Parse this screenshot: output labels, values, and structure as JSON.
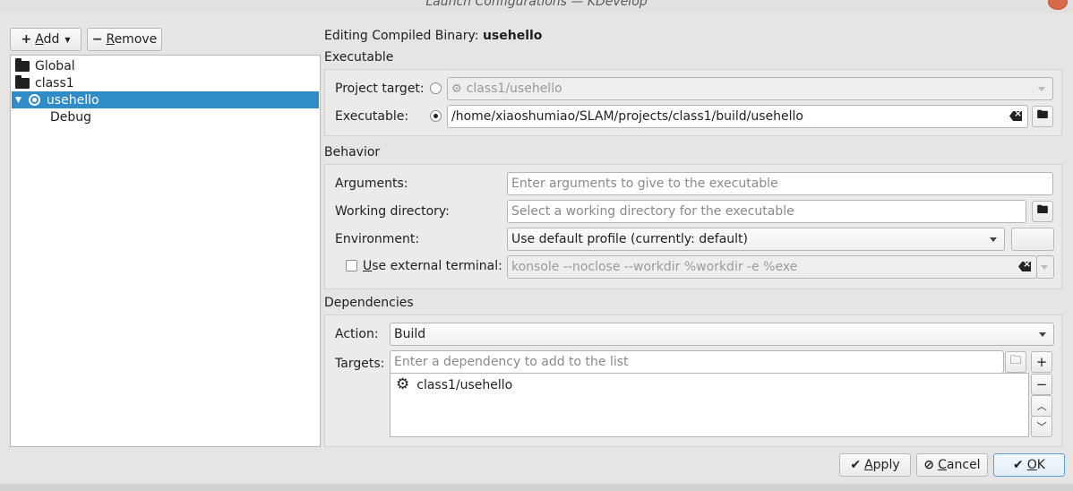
{
  "window": {
    "title": "Launch Configurations — KDevelop"
  },
  "left_toolbar": {
    "add_label": "Add",
    "remove_label": "Remove"
  },
  "tree": {
    "items": [
      {
        "label": "Global"
      },
      {
        "label": "class1"
      },
      {
        "label": "usehello"
      },
      {
        "label": "Debug"
      }
    ]
  },
  "editor": {
    "heading_prefix": "Editing Compiled Binary: ",
    "heading_name": "usehello"
  },
  "executable": {
    "section_title": "Executable",
    "project_target_label": "Project target:",
    "project_target_value": "class1/usehello",
    "executable_label": "Executable:",
    "executable_value": "/home/xiaoshumiao/SLAM/projects/class1/build/usehello"
  },
  "behavior": {
    "section_title": "Behavior",
    "arguments_label": "Arguments:",
    "arguments_placeholder": "Enter arguments to give to the executable",
    "workdir_label": "Working directory:",
    "workdir_placeholder": "Select a working directory for the executable",
    "environment_label": "Environment:",
    "environment_value": "Use default profile (currently: default)",
    "external_terminal_label": "Use external terminal:",
    "external_terminal_value": "konsole --noclose --workdir %workdir -e %exe"
  },
  "dependencies": {
    "section_title": "Dependencies",
    "action_label": "Action:",
    "action_value": "Build",
    "targets_label": "Targets:",
    "targets_placeholder": "Enter a dependency to add to the list",
    "target_items": [
      {
        "label": "class1/usehello"
      }
    ]
  },
  "footer": {
    "apply_label": "Apply",
    "cancel_label": "Cancel",
    "ok_label": "OK"
  }
}
